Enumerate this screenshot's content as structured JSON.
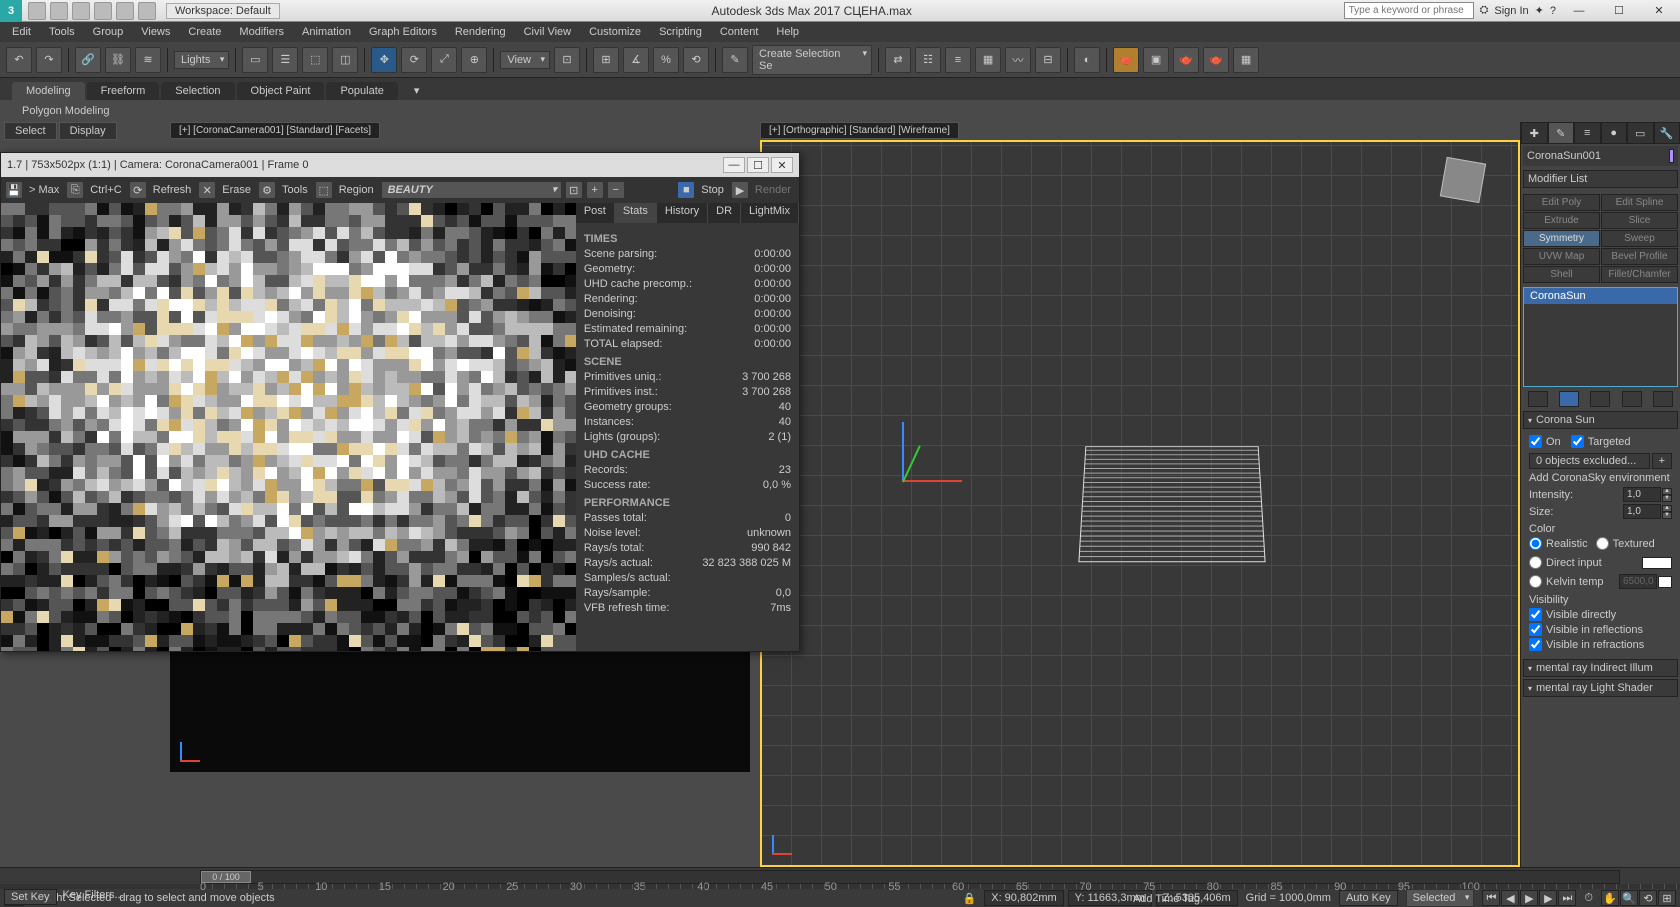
{
  "app": {
    "title": "Autodesk 3ds Max 2017   СЦЕНА.max",
    "workspace": "Workspace: Default",
    "search_placeholder": "Type a keyword or phrase",
    "signin": "Sign In"
  },
  "menu": [
    "Edit",
    "Tools",
    "Group",
    "Views",
    "Create",
    "Modifiers",
    "Animation",
    "Graph Editors",
    "Rendering",
    "Civil View",
    "Customize",
    "Scripting",
    "Content",
    "Help"
  ],
  "toolbar": {
    "lights_dd": "Lights",
    "view_dd": "View",
    "sel_dd": "Create Selection Se"
  },
  "ribbon": {
    "tabs": [
      "Modeling",
      "Freeform",
      "Selection",
      "Object Paint",
      "Populate"
    ],
    "sub": "Polygon Modeling"
  },
  "vp": {
    "select": "Select",
    "display": "Display",
    "left_label": "[+] [CoronaCamera001] [Standard] [Facets]",
    "right_label": "[+] [Orthographic] [Standard] [Wireframe]"
  },
  "vfb": {
    "title": "1.7 | 753x502px (1:1) | Camera: CoronaCamera001 | Frame 0",
    "max": "> Max",
    "ctrlc": "Ctrl+C",
    "refresh": "Refresh",
    "erase": "Erase",
    "tools": "Tools",
    "region": "Region",
    "pass": "BEAUTY",
    "stop": "Stop",
    "render": "Render",
    "tabs": [
      "Post",
      "Stats",
      "History",
      "DR",
      "LightMix"
    ],
    "sections": {
      "TIMES": [
        [
          "Scene parsing:",
          "0:00:00"
        ],
        [
          "Geometry:",
          "0:00:00"
        ],
        [
          "UHD cache precomp.:",
          "0:00:00"
        ],
        [
          "Rendering:",
          "0:00:00"
        ],
        [
          "Denoising:",
          "0:00:00"
        ],
        [
          "Estimated remaining:",
          "0:00:00"
        ],
        [
          "TOTAL elapsed:",
          "0:00:00"
        ]
      ],
      "SCENE": [
        [
          "Primitives uniq.:",
          "3 700 268"
        ],
        [
          "Primitives inst.:",
          "3 700 268"
        ],
        [
          "Geometry groups:",
          "40"
        ],
        [
          "Instances:",
          "40"
        ],
        [
          "Lights (groups):",
          "2 (1)"
        ]
      ],
      "UHD CACHE": [
        [
          "Records:",
          "23"
        ],
        [
          "Success rate:",
          "0,0 %"
        ]
      ],
      "PERFORMANCE": [
        [
          "Passes total:",
          "0"
        ],
        [
          "Noise level:",
          "unknown"
        ],
        [
          "Rays/s total:",
          "990 842"
        ],
        [
          "Rays/s actual:",
          "32 823 388 025 M"
        ],
        [
          "Samples/s actual:",
          ""
        ],
        [
          "Rays/sample:",
          "0,0"
        ],
        [
          "VFB refresh time:",
          "7ms"
        ]
      ]
    }
  },
  "cmd": {
    "object": "CoronaSun001",
    "modlist": "Modifier List",
    "modbtns": [
      "Edit Poly",
      "Edit Spline",
      "Extrude",
      "Slice",
      "Symmetry",
      "Sweep",
      "UVW Map",
      "Bevel Profile",
      "Shell",
      "Fillet/Chamfer"
    ],
    "stack_item": "CoronaSun",
    "rollouts": {
      "corona_sun": {
        "title": "Corona Sun",
        "on": "On",
        "targeted": "Targeted",
        "excluded": "0 objects excluded...",
        "addsky": "Add CoronaSky environment",
        "intensity_lbl": "Intensity:",
        "intensity": "1,0",
        "size_lbl": "Size:",
        "size": "1,0",
        "color_hd": "Color",
        "realistic": "Realistic",
        "textured": "Textured",
        "direct": "Direct input",
        "kelvin": "Kelvin temp",
        "kelvin_val": "6500,0",
        "vis_hd": "Visibility",
        "vis1": "Visible directly",
        "vis2": "Visible in reflections",
        "vis3": "Visible in refractions"
      },
      "mr_illum": "mental ray Indirect Illum",
      "mr_shader": "mental ray Light Shader"
    }
  },
  "status": {
    "slider": "0 / 100",
    "ticks": [
      "0",
      "5",
      "10",
      "15",
      "20",
      "25",
      "30",
      "35",
      "40",
      "45",
      "50",
      "55",
      "60",
      "65",
      "70",
      "75",
      "80",
      "85",
      "90",
      "95",
      "100"
    ],
    "selected": "1 Light Selected",
    "prompt": "drag to select and move objects",
    "x": "X: 90,802mm",
    "y": "Y: 11663,3mm",
    "z": "Z: 5305,406m",
    "grid": "Grid = 1000,0mm",
    "autokey": "Auto Key",
    "setkey": "Set Key",
    "selmode": "Selected",
    "keyfilters": "Key Filters...",
    "addtime": "Add Time Tag"
  }
}
